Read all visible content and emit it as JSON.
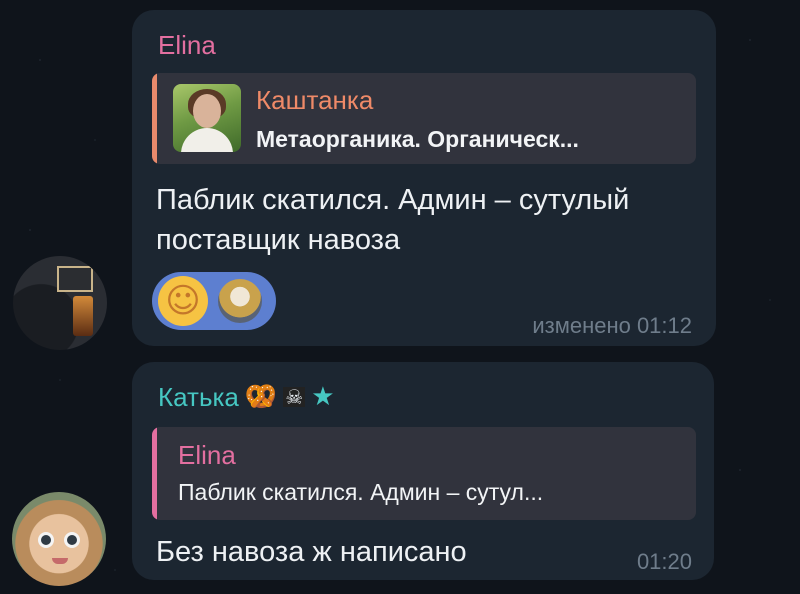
{
  "background": {
    "color": "#0f141b"
  },
  "messages": [
    {
      "sender": "Elina",
      "sender_color": "#e36fa0",
      "reply": {
        "title": "Каштанка",
        "text": "Метаорганика. Органическ...",
        "title_color": "#ef8a68"
      },
      "text": "Паблик скатился. Админ – сутулый поставщик навоза",
      "reactions": [
        {
          "type": "emoji",
          "icon": "smiling-face-with-hearts-icon",
          "glyph": "☺"
        },
        {
          "type": "avatar",
          "icon": "user-avatar-icon"
        }
      ],
      "meta": "изменено 01:12"
    },
    {
      "sender": "Катька",
      "sender_color": "#46c7c2",
      "sender_badges": {
        "pretzel": "🥨",
        "flag": "☠",
        "star": "★"
      },
      "reply": {
        "title": "Elina",
        "text": "Паблик скатился. Админ – сутул...",
        "title_color": "#e36fa0"
      },
      "text": "Без навоза ж написано",
      "meta": "01:20"
    }
  ],
  "bubble_color": "#1c2631",
  "reply_bg": "#31333d",
  "meta_color": "#6f7d8b"
}
